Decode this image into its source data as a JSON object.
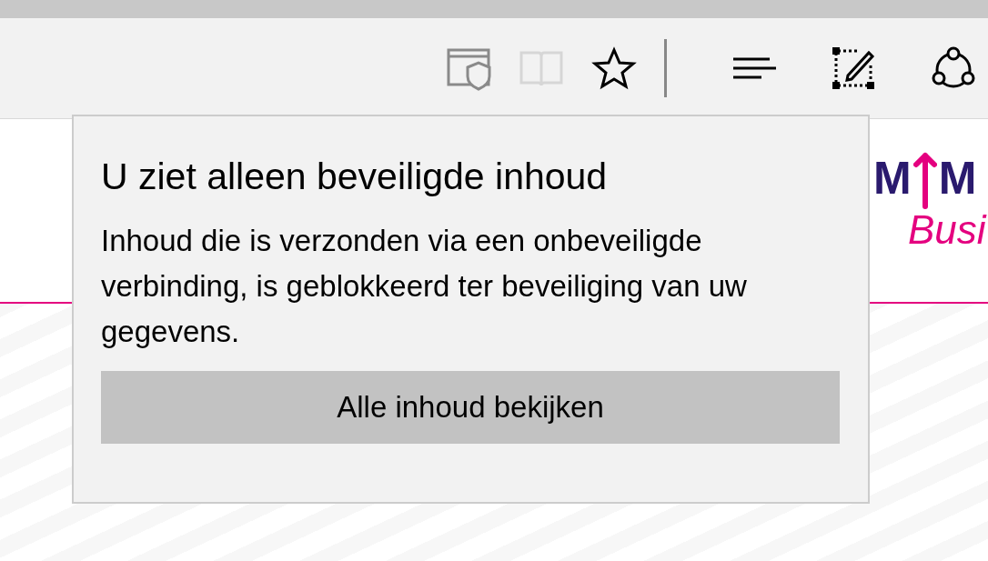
{
  "toolbar": {
    "buttons": [
      {
        "kind": "shield",
        "disabled": false
      },
      {
        "kind": "book",
        "disabled": true
      },
      {
        "kind": "star",
        "disabled": false
      },
      {
        "kind": "divider"
      },
      {
        "kind": "hub",
        "disabled": false
      },
      {
        "kind": "note",
        "disabled": false
      },
      {
        "kind": "share",
        "disabled": false
      }
    ]
  },
  "page": {
    "logo_letters": [
      "M",
      "M"
    ],
    "logo_subtext": "Busi"
  },
  "popup": {
    "title": "U ziet alleen beveiligde inhoud",
    "message": "Inhoud die is verzonden via een onbeveiligde verbinding, is geblokkeerd ter beveiliging van uw gegevens.",
    "button": "Alle inhoud bekijken"
  }
}
